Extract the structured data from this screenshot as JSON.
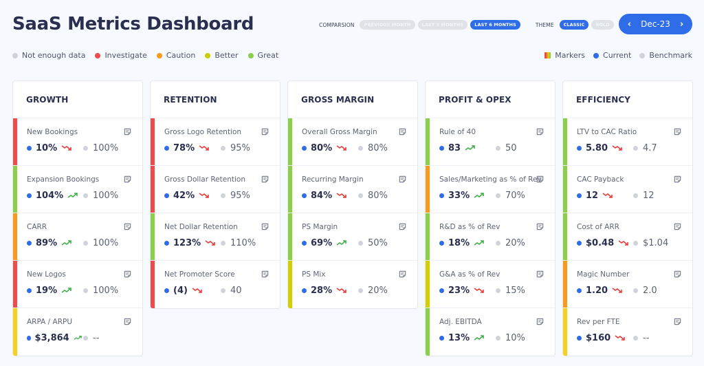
{
  "header": {
    "title": "SaaS Metrics Dashboard",
    "comparison_label": "COMPARSION",
    "comparison_options": [
      {
        "label": "PREVIOUS MONTH",
        "active": false
      },
      {
        "label": "LAST 3 MONTHS",
        "active": false
      },
      {
        "label": "LAST 6 MONTHS",
        "active": true
      }
    ],
    "theme_label": "THEME",
    "theme_options": [
      {
        "label": "CLASSIC",
        "active": true
      },
      {
        "label": "BOLD",
        "active": false
      }
    ],
    "date": {
      "label": "Dec-23",
      "prev_icon": "chevron-left-icon",
      "next_icon": "chevron-right-icon"
    }
  },
  "status_legend": [
    {
      "label": "Not enough data",
      "color": "#cfd2d8"
    },
    {
      "label": "Investigate",
      "color": "#f04a4a"
    },
    {
      "label": "Caution",
      "color": "#f89b1c"
    },
    {
      "label": "Better",
      "color": "#c9cf00"
    },
    {
      "label": "Great",
      "color": "#8ccf4a"
    }
  ],
  "value_legend": {
    "markers": "Markers",
    "current": "Current",
    "benchmark": "Benchmark",
    "current_color": "#2f6ce8",
    "benchmark_color": "#d0d3d9"
  },
  "status_colors": {
    "investigate": "#f04a4a",
    "caution": "#f89b1c",
    "better": "#d4d000",
    "better_yellow": "#f5d21c",
    "great": "#8ccf4a"
  },
  "trend_colors": {
    "up": "#3fae4a",
    "down": "#ea3a3a"
  },
  "columns": [
    {
      "title": "GROWTH",
      "metrics": [
        {
          "name": "New Bookings",
          "current": "10%",
          "benchmark": "100%",
          "trend": "down",
          "status": "investigate"
        },
        {
          "name": "Expansion Bookings",
          "current": "104%",
          "benchmark": "100%",
          "trend": "up",
          "status": "great"
        },
        {
          "name": "CARR",
          "current": "89%",
          "benchmark": "100%",
          "trend": "up",
          "status": "caution"
        },
        {
          "name": "New Logos",
          "current": "19%",
          "benchmark": "100%",
          "trend": "up",
          "status": "investigate"
        },
        {
          "name": "ARPA / ARPU",
          "current": "$3,864",
          "benchmark": "--",
          "trend": "up",
          "status": "better_yellow"
        }
      ]
    },
    {
      "title": "RETENTION",
      "metrics": [
        {
          "name": "Gross Logo Retention",
          "current": "78%",
          "benchmark": "95%",
          "trend": "down",
          "status": "investigate"
        },
        {
          "name": "Gross Dollar Retention",
          "current": "42%",
          "benchmark": "95%",
          "trend": "down",
          "status": "investigate"
        },
        {
          "name": "Net Dollar Retention",
          "current": "123%",
          "benchmark": "110%",
          "trend": "down",
          "status": "great"
        },
        {
          "name": "Net Promoter Score",
          "current": "(4)",
          "benchmark": "40",
          "trend": "down",
          "status": "investigate"
        }
      ]
    },
    {
      "title": "GROSS MARGIN",
      "metrics": [
        {
          "name": "Overall Gross Margin",
          "current": "80%",
          "benchmark": "80%",
          "trend": "down",
          "status": "great"
        },
        {
          "name": "Recurring Margin",
          "current": "84%",
          "benchmark": "80%",
          "trend": "down",
          "status": "great"
        },
        {
          "name": "PS Margin",
          "current": "69%",
          "benchmark": "50%",
          "trend": "up",
          "status": "great"
        },
        {
          "name": "PS Mix",
          "current": "28%",
          "benchmark": "20%",
          "trend": "down",
          "status": "better"
        }
      ]
    },
    {
      "title": "PROFIT & OPEX",
      "metrics": [
        {
          "name": "Rule of 40",
          "current": "83",
          "benchmark": "50",
          "trend": "up",
          "status": "great"
        },
        {
          "name": "Sales/Marketing as % of Rev",
          "current": "33%",
          "benchmark": "70%",
          "trend": "up",
          "status": "caution"
        },
        {
          "name": "R&D as % of Rev",
          "current": "18%",
          "benchmark": "20%",
          "trend": "up",
          "status": "great"
        },
        {
          "name": "G&A as % of Rev",
          "current": "23%",
          "benchmark": "15%",
          "trend": "down",
          "status": "better"
        },
        {
          "name": "Adj. EBITDA",
          "current": "13%",
          "benchmark": "10%",
          "trend": "up",
          "status": "great"
        }
      ]
    },
    {
      "title": "EFFICIENCY",
      "metrics": [
        {
          "name": "LTV to CAC Ratio",
          "current": "5.80",
          "benchmark": "4.7",
          "trend": "down",
          "status": "great"
        },
        {
          "name": "CAC Payback",
          "current": "12",
          "benchmark": "12",
          "trend": "down",
          "status": "great"
        },
        {
          "name": "Cost of ARR",
          "current": "$0.48",
          "benchmark": "$1.04",
          "trend": "down",
          "status": "great"
        },
        {
          "name": "Magic Number",
          "current": "1.20",
          "benchmark": "2.0",
          "trend": "down",
          "status": "caution"
        },
        {
          "name": "Rev per FTE",
          "current": "$160",
          "benchmark": "--",
          "trend": "down",
          "status": "better_yellow"
        }
      ]
    }
  ]
}
